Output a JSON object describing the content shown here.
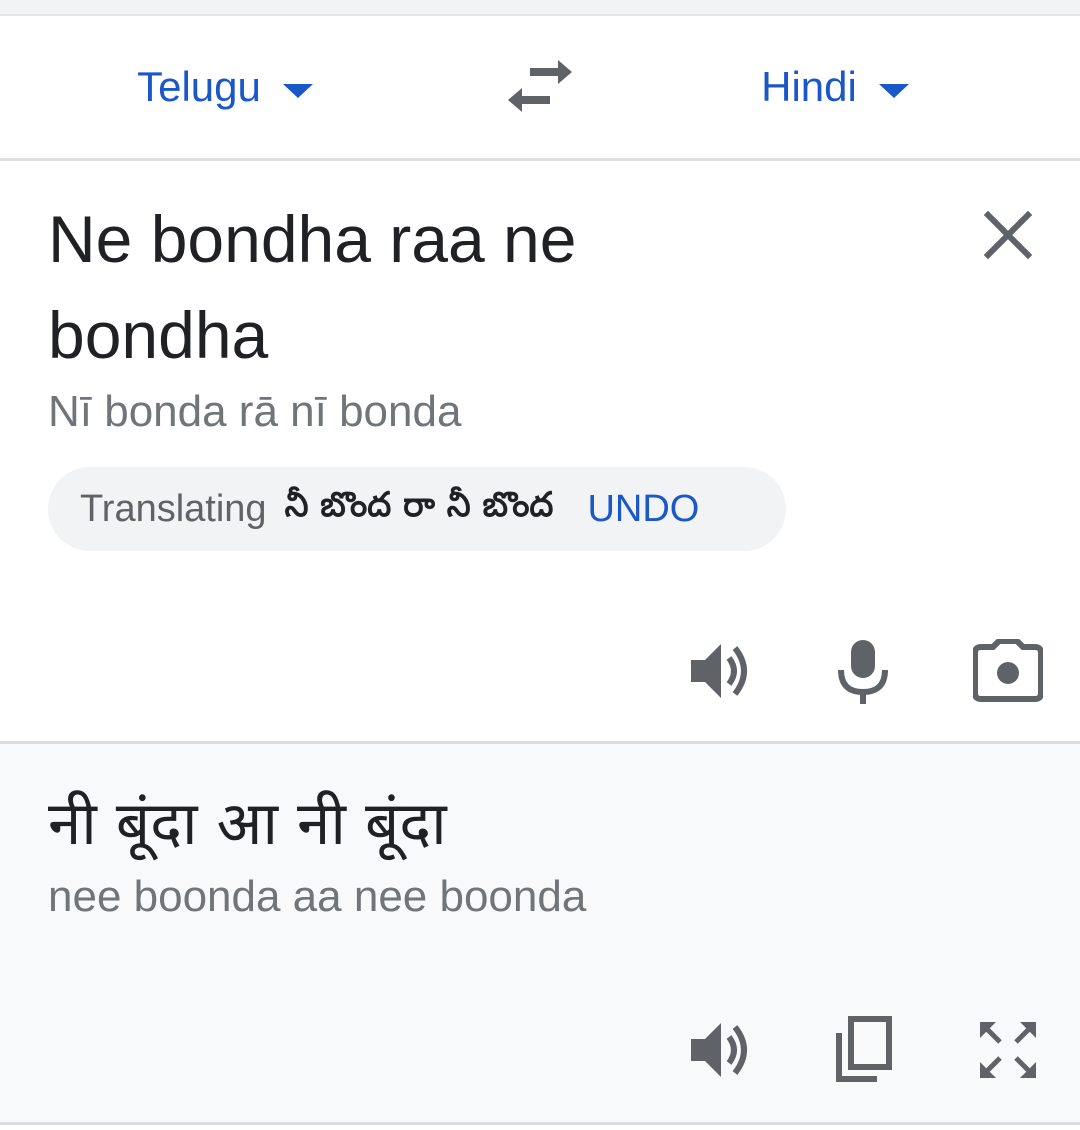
{
  "languages": {
    "source": "Telugu",
    "target": "Hindi"
  },
  "input": {
    "text": "Ne bondha raa ne bondha",
    "transliteration": "Nī bonda rā nī bonda"
  },
  "suggestion": {
    "label": "Translating",
    "text": "నీ బొంద రా నీ బొంద",
    "undo_label": "UNDO"
  },
  "output": {
    "text": "नी बूंदा आ नी बूंदा",
    "transliteration": "nee boonda aa nee boonda"
  },
  "icons": {
    "swap": "swap-languages-icon",
    "clear": "close-icon",
    "speak_input": "speaker-icon",
    "mic": "microphone-icon",
    "camera": "camera-icon",
    "speak_output": "speaker-icon",
    "copy": "copy-icon",
    "fullscreen": "fullscreen-icon"
  },
  "colors": {
    "accent": "#1a57c9",
    "text_primary": "#202124",
    "text_secondary": "#70757a",
    "icon": "#5f6368",
    "output_bg": "#f8f9fa"
  }
}
